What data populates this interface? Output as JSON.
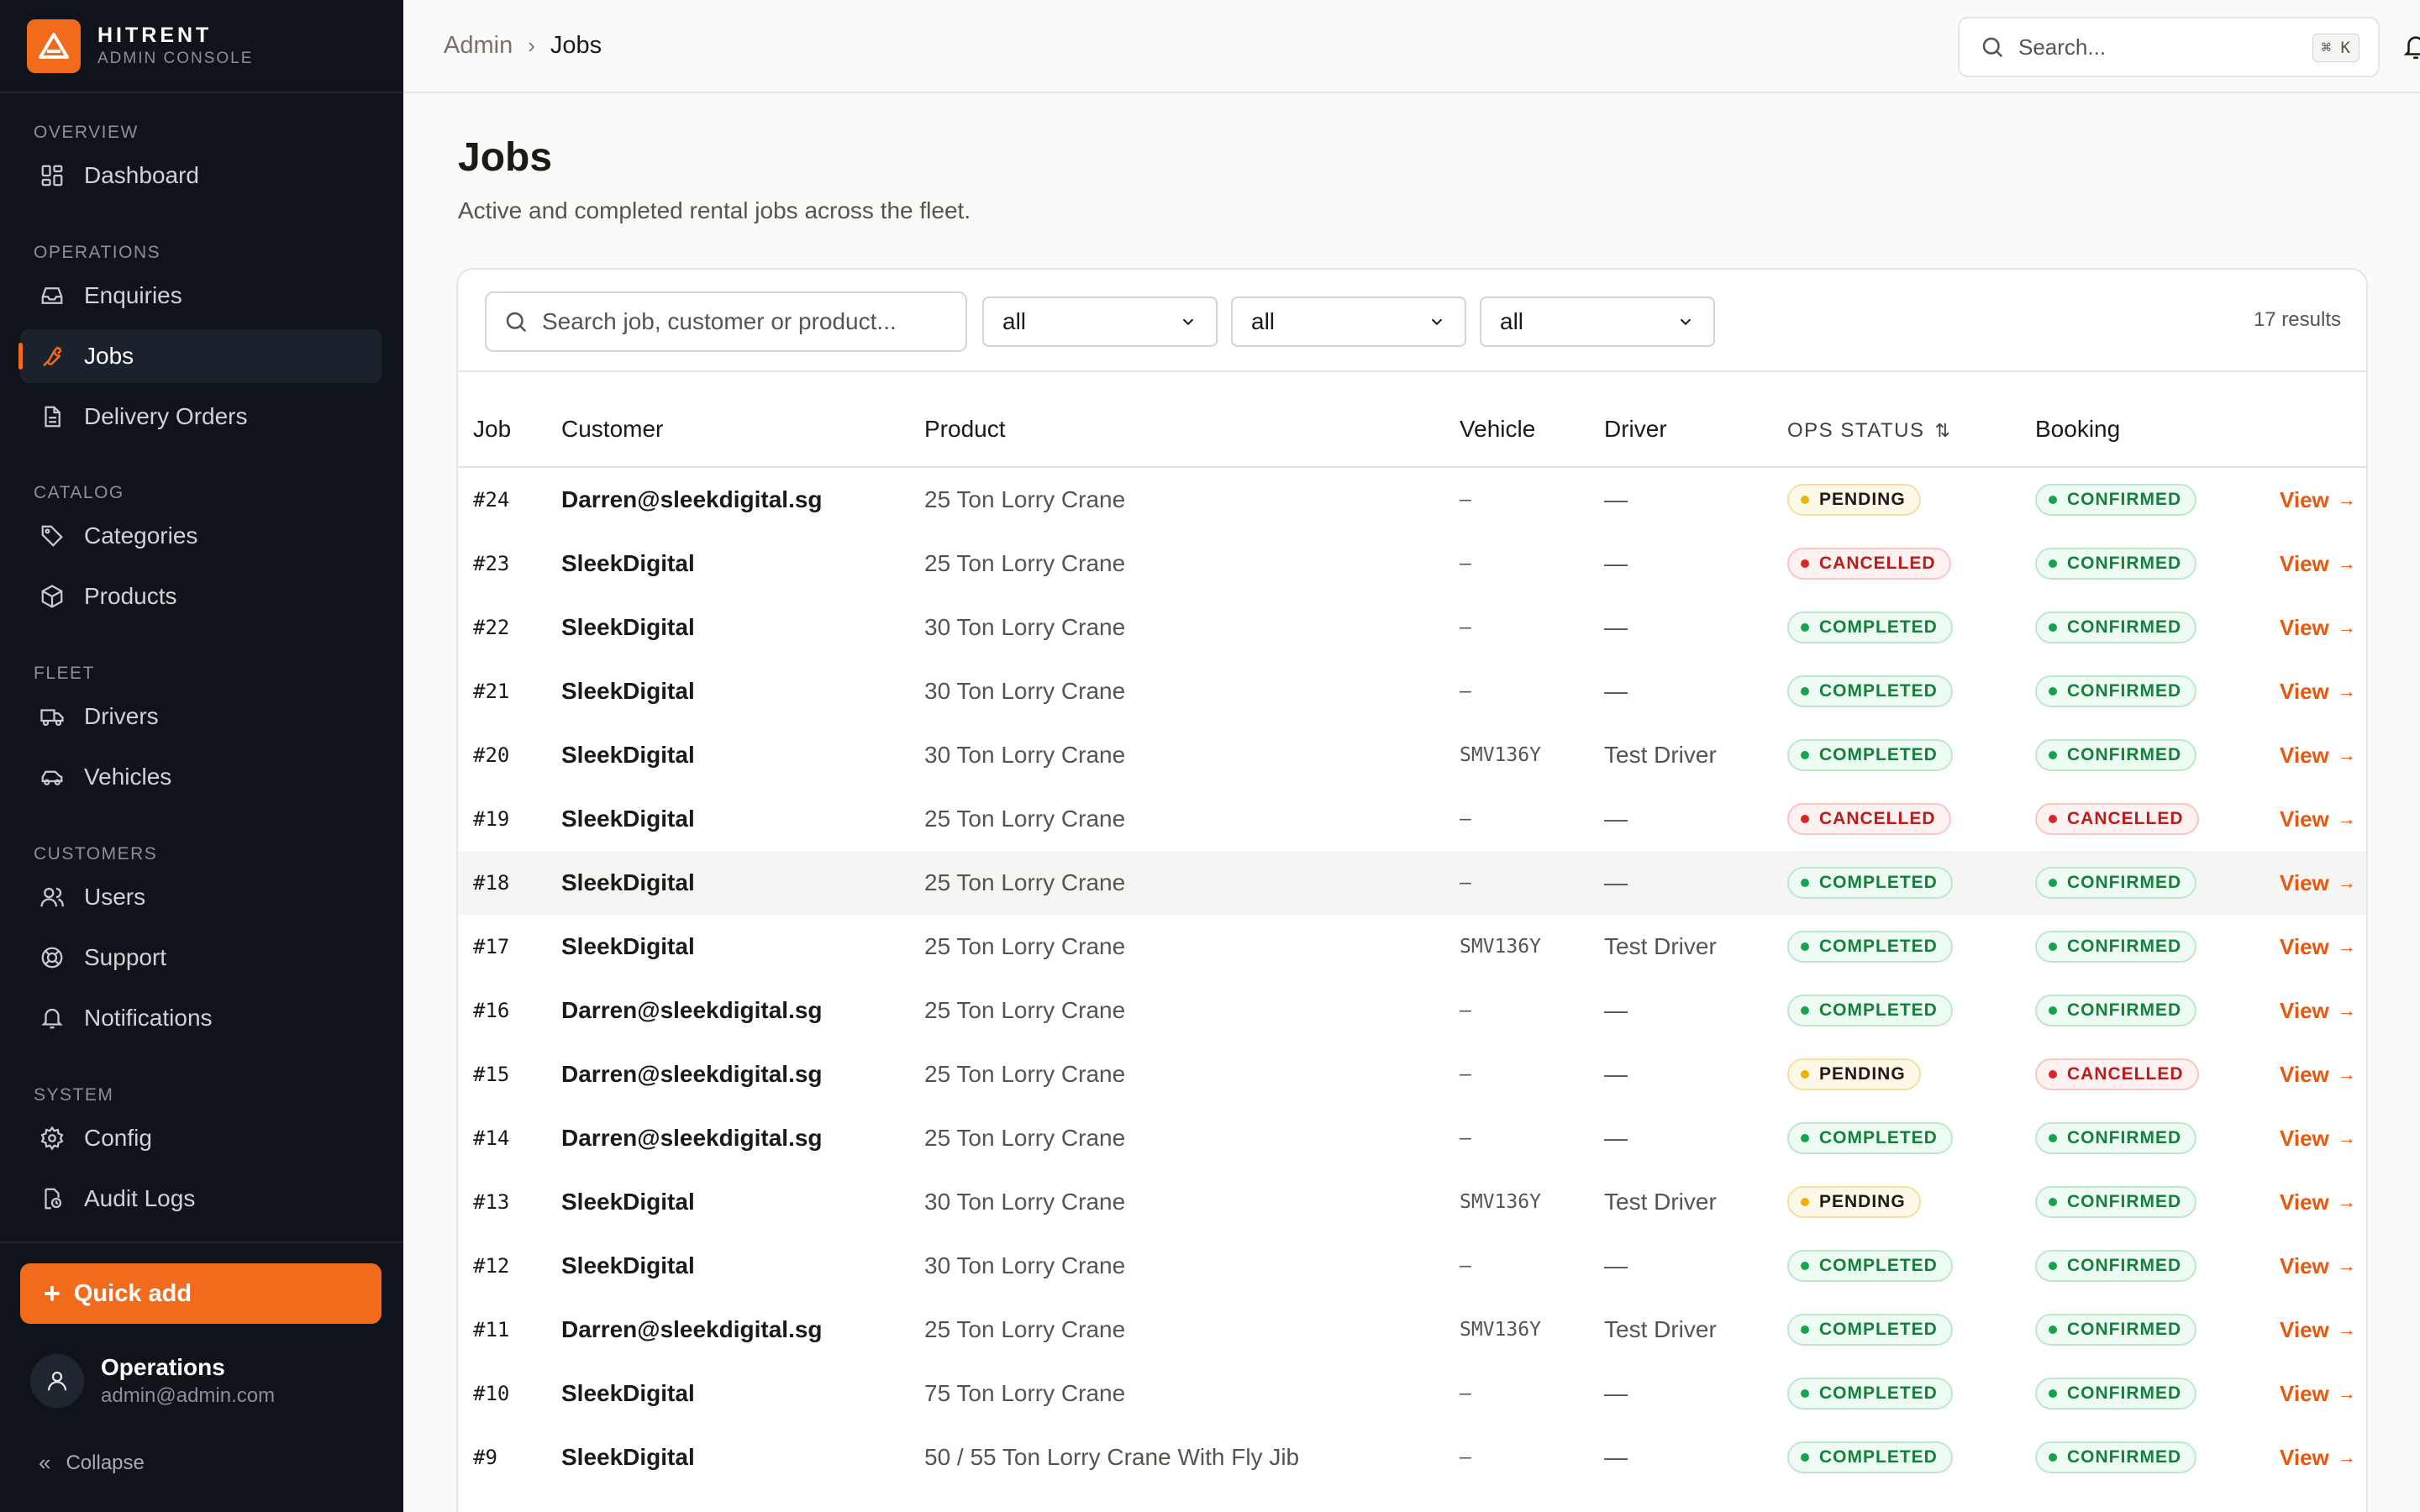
{
  "brand": {
    "name": "HITRENT",
    "subtitle": "ADMIN CONSOLE"
  },
  "nav": {
    "sections": [
      "OVERVIEW",
      "OPERATIONS",
      "CATALOG",
      "FLEET",
      "CUSTOMERS",
      "SYSTEM"
    ],
    "items": [
      {
        "label": "Dashboard",
        "icon": "dashboard-icon"
      },
      {
        "label": "Enquiries",
        "icon": "inbox-icon"
      },
      {
        "label": "Jobs",
        "icon": "wrench-icon",
        "active": true
      },
      {
        "label": "Delivery Orders",
        "icon": "document-icon"
      },
      {
        "label": "Categories",
        "icon": "tag-icon"
      },
      {
        "label": "Products",
        "icon": "box-icon"
      },
      {
        "label": "Drivers",
        "icon": "truck-icon"
      },
      {
        "label": "Vehicles",
        "icon": "car-icon"
      },
      {
        "label": "Users",
        "icon": "users-icon"
      },
      {
        "label": "Support",
        "icon": "lifebuoy-icon"
      },
      {
        "label": "Notifications",
        "icon": "bell-icon"
      },
      {
        "label": "Config",
        "icon": "gear-icon"
      },
      {
        "label": "Audit Logs",
        "icon": "audit-icon"
      }
    ]
  },
  "quick_add": {
    "label": "Quick add"
  },
  "user": {
    "name": "Operations",
    "email": "admin@admin.com"
  },
  "collapse": {
    "label": "Collapse"
  },
  "topbar": {
    "breadcrumb": {
      "parent": "Admin",
      "current": "Jobs"
    },
    "search_placeholder": "Search...",
    "shortcut": "⌘ K"
  },
  "page": {
    "title": "Jobs",
    "subtitle": "Active and completed rental jobs across the fleet."
  },
  "filters": {
    "search_placeholder": "Search job, customer or product...",
    "select_1": "all",
    "select_2": "all",
    "select_3": "all",
    "results": "17 results"
  },
  "columns": {
    "job": "Job",
    "customer": "Customer",
    "product": "Product",
    "vehicle": "Vehicle",
    "driver": "Driver",
    "ops_status": "OPS STATUS",
    "booking": "Booking"
  },
  "view_label": "View",
  "colors": {
    "accent": "#f26a1b",
    "sidebar_bg": "#0f141b",
    "link": "#ea580c"
  },
  "rows": [
    {
      "job": "#24",
      "customer": "Darren@sleekdigital.sg",
      "product": "25 Ton Lorry Crane",
      "vehicle": "–",
      "driver": "—",
      "ops": "PENDING",
      "booking": "CONFIRMED"
    },
    {
      "job": "#23",
      "customer": "SleekDigital",
      "product": "25 Ton Lorry Crane",
      "vehicle": "–",
      "driver": "—",
      "ops": "CANCELLED",
      "booking": "CONFIRMED"
    },
    {
      "job": "#22",
      "customer": "SleekDigital",
      "product": "30 Ton Lorry Crane",
      "vehicle": "–",
      "driver": "—",
      "ops": "COMPLETED",
      "booking": "CONFIRMED"
    },
    {
      "job": "#21",
      "customer": "SleekDigital",
      "product": "30 Ton Lorry Crane",
      "vehicle": "–",
      "driver": "—",
      "ops": "COMPLETED",
      "booking": "CONFIRMED"
    },
    {
      "job": "#20",
      "customer": "SleekDigital",
      "product": "30 Ton Lorry Crane",
      "vehicle": "SMV136Y",
      "driver": "Test Driver",
      "ops": "COMPLETED",
      "booking": "CONFIRMED"
    },
    {
      "job": "#19",
      "customer": "SleekDigital",
      "product": "25 Ton Lorry Crane",
      "vehicle": "–",
      "driver": "—",
      "ops": "CANCELLED",
      "booking": "CANCELLED"
    },
    {
      "job": "#18",
      "customer": "SleekDigital",
      "product": "25 Ton Lorry Crane",
      "vehicle": "–",
      "driver": "—",
      "ops": "COMPLETED",
      "booking": "CONFIRMED",
      "hover": true
    },
    {
      "job": "#17",
      "customer": "SleekDigital",
      "product": "25 Ton Lorry Crane",
      "vehicle": "SMV136Y",
      "driver": "Test Driver",
      "ops": "COMPLETED",
      "booking": "CONFIRMED"
    },
    {
      "job": "#16",
      "customer": "Darren@sleekdigital.sg",
      "product": "25 Ton Lorry Crane",
      "vehicle": "–",
      "driver": "—",
      "ops": "COMPLETED",
      "booking": "CONFIRMED"
    },
    {
      "job": "#15",
      "customer": "Darren@sleekdigital.sg",
      "product": "25 Ton Lorry Crane",
      "vehicle": "–",
      "driver": "—",
      "ops": "PENDING",
      "booking": "CANCELLED"
    },
    {
      "job": "#14",
      "customer": "Darren@sleekdigital.sg",
      "product": "25 Ton Lorry Crane",
      "vehicle": "–",
      "driver": "—",
      "ops": "COMPLETED",
      "booking": "CONFIRMED"
    },
    {
      "job": "#13",
      "customer": "SleekDigital",
      "product": "30 Ton Lorry Crane",
      "vehicle": "SMV136Y",
      "driver": "Test Driver",
      "ops": "PENDING",
      "booking": "CONFIRMED"
    },
    {
      "job": "#12",
      "customer": "SleekDigital",
      "product": "30 Ton Lorry Crane",
      "vehicle": "–",
      "driver": "—",
      "ops": "COMPLETED",
      "booking": "CONFIRMED"
    },
    {
      "job": "#11",
      "customer": "Darren@sleekdigital.sg",
      "product": "25 Ton Lorry Crane",
      "vehicle": "SMV136Y",
      "driver": "Test Driver",
      "ops": "COMPLETED",
      "booking": "CONFIRMED"
    },
    {
      "job": "#10",
      "customer": "SleekDigital",
      "product": "75 Ton Lorry Crane",
      "vehicle": "–",
      "driver": "—",
      "ops": "COMPLETED",
      "booking": "CONFIRMED"
    },
    {
      "job": "#9",
      "customer": "SleekDigital",
      "product": "50 / 55 Ton Lorry Crane With Fly Jib",
      "vehicle": "–",
      "driver": "—",
      "ops": "COMPLETED",
      "booking": "CONFIRMED"
    }
  ]
}
